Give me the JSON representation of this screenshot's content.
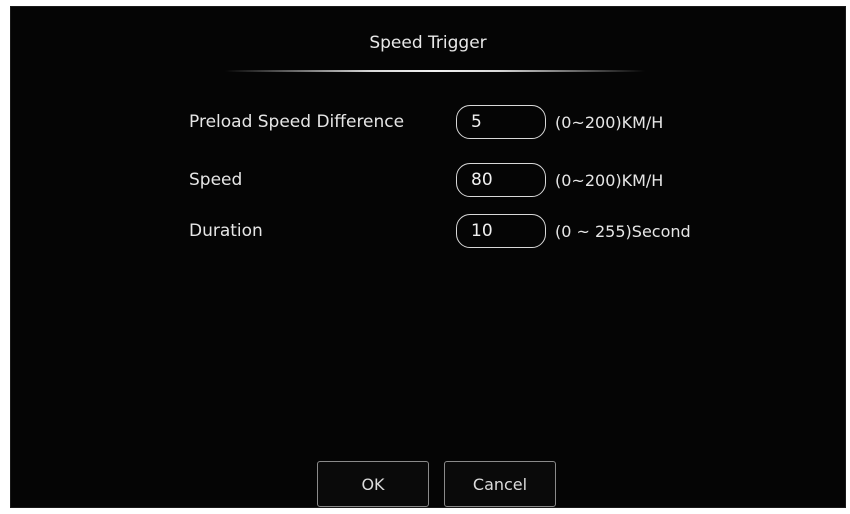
{
  "dialog": {
    "title": "Speed Trigger"
  },
  "fields": [
    {
      "label": "Preload Speed Difference",
      "value": "5",
      "range": "(0~200)KM/H"
    },
    {
      "label": "Speed",
      "value": "80",
      "range": "(0~200)KM/H"
    },
    {
      "label": "Duration",
      "value": "10",
      "range": "(0 ~ 255)Second"
    }
  ],
  "buttons": {
    "ok_label": "OK",
    "cancel_label": "Cancel"
  }
}
